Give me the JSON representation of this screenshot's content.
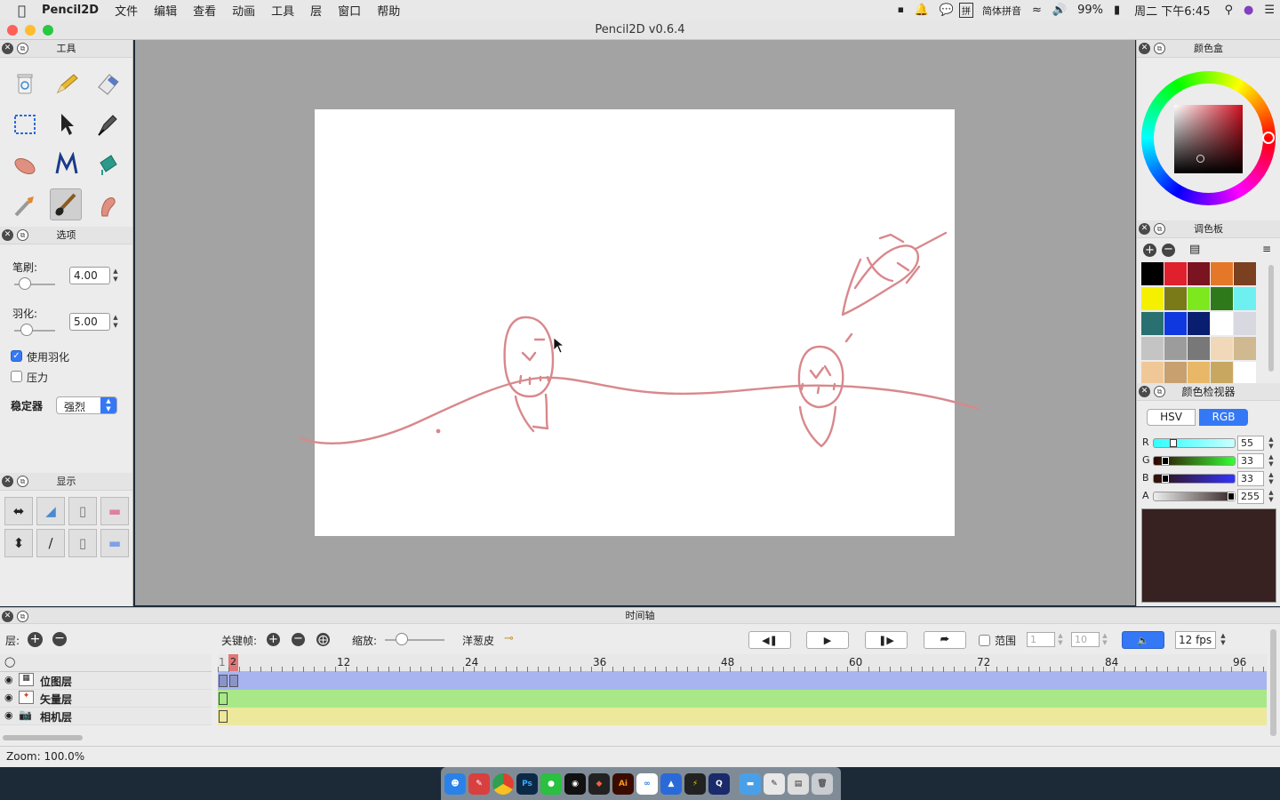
{
  "menubar": {
    "app_name": "Pencil2D",
    "items": [
      "文件",
      "编辑",
      "查看",
      "动画",
      "工具",
      "层",
      "窗口",
      "帮助"
    ],
    "input_method": "简体拼音",
    "battery": "99%",
    "clock": "周二 下午6:45"
  },
  "window": {
    "title": "Pencil2D v0.6.4"
  },
  "tools_panel": {
    "title": "工具"
  },
  "options_panel": {
    "title": "选项",
    "brush_label": "笔刷:",
    "brush_value": "4.00",
    "feather_label": "羽化:",
    "feather_value": "5.00",
    "use_feather_label": "使用羽化",
    "use_feather_checked": true,
    "pressure_label": "压力",
    "pressure_checked": false,
    "stabilizer_label": "稳定器",
    "stabilizer_value": "强烈"
  },
  "display_panel": {
    "title": "显示"
  },
  "color_box": {
    "title": "颜色盒"
  },
  "palette": {
    "title": "调色板",
    "swatches": [
      "#000000",
      "#e0202c",
      "#7a1420",
      "#e57828",
      "#7a4020",
      "#f4f000",
      "#7a7a18",
      "#7de81e",
      "#2e7a1a",
      "#6ef0f0",
      "#2a7070",
      "#1038e0",
      "#0a1e70",
      "#ffffff",
      "#d8d8e0",
      "#c4c4c4",
      "#9c9c9c",
      "#787878",
      "#f0d8b8",
      "#d0b890",
      "#f0c898",
      "#c8a070",
      "#e8b868",
      "#c8a860",
      "#ffffff"
    ]
  },
  "color_inspector": {
    "title": "颜色检视器",
    "tab_hsv": "HSV",
    "tab_rgb": "RGB",
    "r_label": "R",
    "r_value": "55",
    "g_label": "G",
    "g_value": "33",
    "b_label": "B",
    "b_value": "33",
    "a_label": "A",
    "a_value": "255",
    "current_color": "#372121"
  },
  "timeline": {
    "title": "时间轴",
    "layers_label": "层:",
    "keyframe_label": "关键帧:",
    "zoom_label": "缩放:",
    "onion_label": "洋葱皮",
    "range_label": "范围",
    "range_start": "1",
    "range_end": "10",
    "fps": "12 fps",
    "current_frame": "2",
    "ruler_marks": [
      "1",
      "12",
      "24",
      "36",
      "48",
      "60",
      "72",
      "84",
      "96"
    ],
    "layers": [
      {
        "name": "位图层",
        "color": "#a8b4f0"
      },
      {
        "name": "矢量层",
        "color": "#a8e888"
      },
      {
        "name": "相机层",
        "color": "#ece89c"
      }
    ]
  },
  "status": {
    "zoom": "Zoom: 100.0%"
  },
  "dock": {
    "apps": [
      "finder-icon",
      "pencil2d-icon",
      "chrome-icon",
      "photoshop-icon",
      "wechat-icon",
      "qq-icon",
      "figma-icon",
      "illustrator-icon",
      "baidu-netdisk-icon",
      "app-icon",
      "fiddler-icon",
      "quicktime-icon",
      "folder-icon",
      "preview-icon",
      "notes-icon",
      "trash-icon"
    ]
  }
}
